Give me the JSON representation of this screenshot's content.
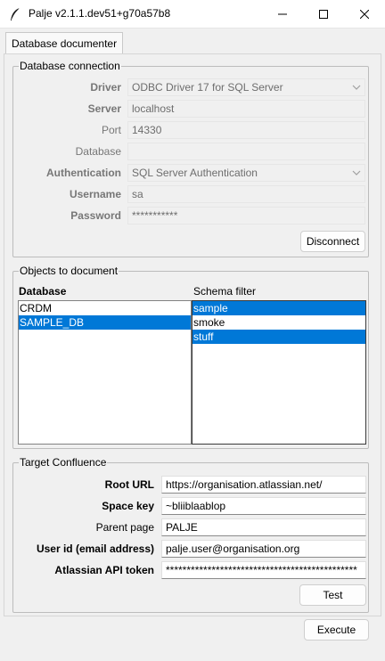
{
  "window": {
    "title": "Palje v2.1.1.dev51+g70a57b8"
  },
  "tab": {
    "label": "Database documenter"
  },
  "db_connection": {
    "title": "Database connection",
    "driver_label": "Driver",
    "driver_value": "ODBC Driver 17 for SQL Server",
    "server_label": "Server",
    "server_value": "localhost",
    "port_label": "Port",
    "port_value": "14330",
    "database_label": "Database",
    "database_value": "",
    "auth_label": "Authentication",
    "auth_value": "SQL Server Authentication",
    "username_label": "Username",
    "username_value": "sa",
    "password_label": "Password",
    "password_value": "***********",
    "disconnect_label": "Disconnect"
  },
  "objects": {
    "title": "Objects to document",
    "database_header": "Database",
    "schema_header": "Schema filter",
    "databases": [
      {
        "name": "CRDM",
        "selected": false
      },
      {
        "name": "SAMPLE_DB",
        "selected": true
      }
    ],
    "schemas": [
      {
        "name": "sample",
        "selected": true
      },
      {
        "name": "smoke",
        "selected": false
      },
      {
        "name": "stuff",
        "selected": true
      }
    ]
  },
  "confluence": {
    "title": "Target Confluence",
    "root_url_label": "Root URL",
    "root_url_value": "https://organisation.atlassian.net/",
    "space_key_label": "Space key",
    "space_key_value": "~bliiblaablop",
    "parent_page_label": "Parent page",
    "parent_page_value": "PALJE",
    "user_id_label": "User id (email address)",
    "user_id_value": "palje.user@organisation.org",
    "api_token_label": "Atlassian API token",
    "api_token_value": "**********************************************",
    "test_label": "Test"
  },
  "footer": {
    "execute_label": "Execute"
  },
  "colors": {
    "selection": "#0078d7",
    "background": "#f0f0f0"
  },
  "icons": {
    "app": "feather-icon",
    "minimize": "minimize-icon",
    "maximize": "maximize-icon",
    "close": "close-icon",
    "dropdown": "chevron-down-icon"
  }
}
